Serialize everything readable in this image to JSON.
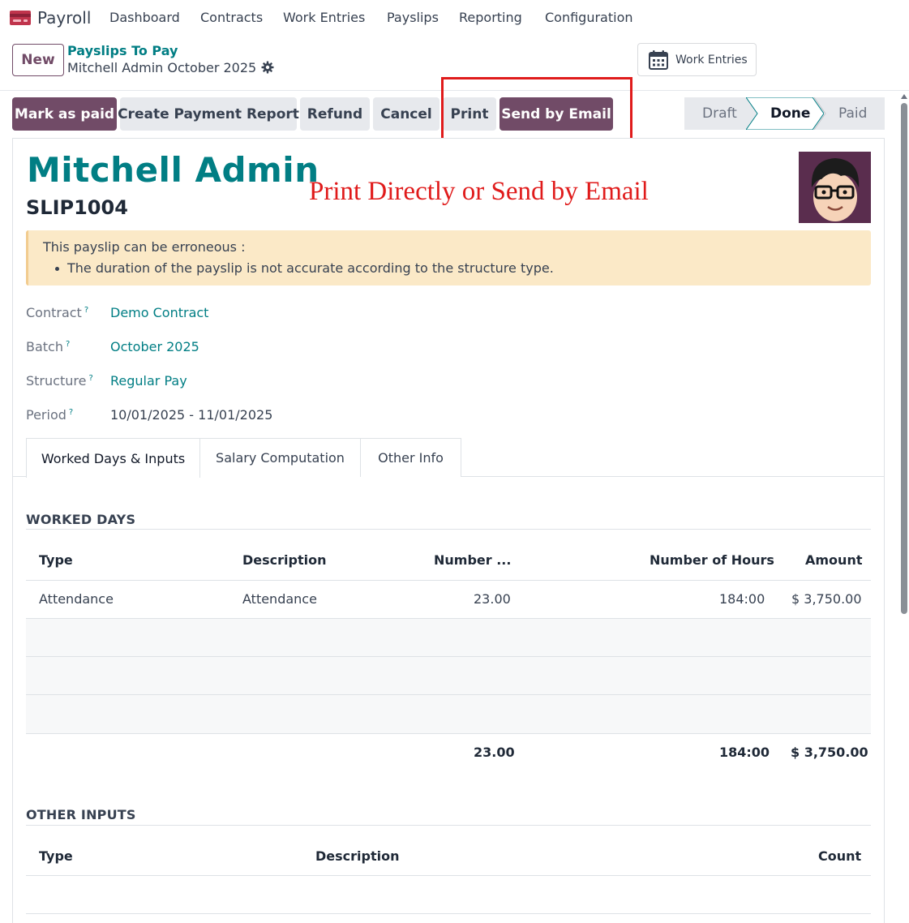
{
  "nav": {
    "app_name": "Payroll",
    "menu": [
      "Dashboard",
      "Contracts",
      "Work Entries",
      "Payslips",
      "Reporting",
      "Configuration"
    ]
  },
  "control_panel": {
    "new_label": "New",
    "breadcrumb": "Payslips To Pay",
    "record_name": "Mitchell Admin October 2025",
    "work_entries_label": "Work Entries"
  },
  "actions": {
    "mark_paid": "Mark as paid",
    "payment_report": "Create Payment Report",
    "refund": "Refund",
    "cancel": "Cancel",
    "print": "Print",
    "send_email": "Send by Email"
  },
  "status": {
    "steps": [
      "Draft",
      "Done",
      "Paid"
    ],
    "current": "Done"
  },
  "annotation": "Print Directly or Send by Email",
  "form": {
    "employee": "Mitchell Admin",
    "reference": "SLIP1004",
    "warning": {
      "title": "This payslip can be erroneous :",
      "items": [
        "The duration of the payslip is not accurate according to the structure type."
      ]
    },
    "fields": {
      "contract": {
        "label": "Contract",
        "help": "?",
        "value": "Demo Contract"
      },
      "batch": {
        "label": "Batch",
        "help": "?",
        "value": "October 2025"
      },
      "structure": {
        "label": "Structure",
        "help": "?",
        "value": "Regular Pay"
      },
      "period": {
        "label": "Period",
        "help": "?",
        "value": "10/01/2025 - 11/01/2025"
      }
    }
  },
  "tabs": [
    "Worked Days & Inputs",
    "Salary Computation",
    "Other Info"
  ],
  "worked_days": {
    "title": "WORKED DAYS",
    "headers": [
      "Type",
      "Description",
      "Number ...",
      "Number of Hours",
      "Amount"
    ],
    "rows": [
      [
        "Attendance",
        "Attendance",
        "23.00",
        "184:00",
        "$ 3,750.00"
      ]
    ],
    "totals": [
      "23.00",
      "184:00",
      "$ 3,750.00"
    ]
  },
  "other_inputs": {
    "title": "OTHER INPUTS",
    "headers": [
      "Type",
      "Description",
      "Count"
    ]
  },
  "colors": {
    "primary": "#714b67",
    "link": "#017e84",
    "highlight": "#e01b1b",
    "warning_bg": "#fbe9c7"
  },
  "icons": [
    "payroll-app-icon",
    "gear-icon",
    "calendar-icon",
    "avatar"
  ]
}
